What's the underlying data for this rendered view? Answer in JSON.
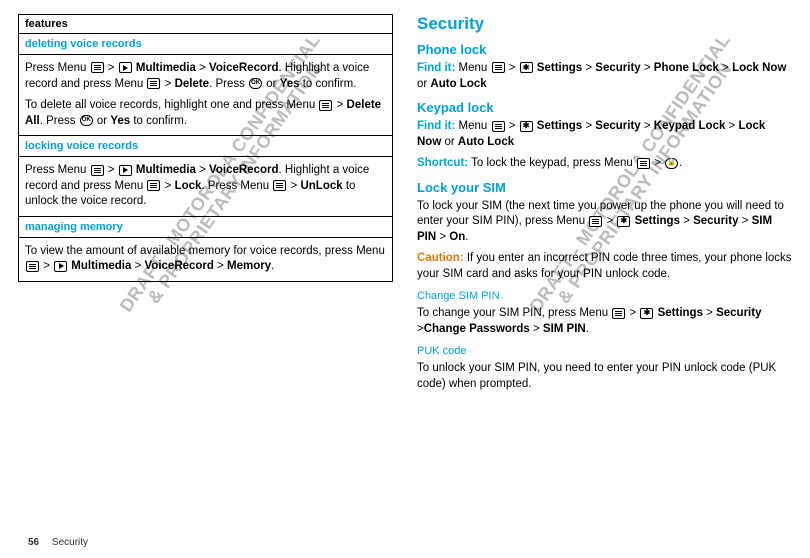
{
  "watermark": "DRAFT - MOTOROLA CONFIDENTIAL\n& PROPRIETARY INFORMATION",
  "left": {
    "features": "features",
    "s1_title": "deleting voice records",
    "s1_p1a": "Press Menu ",
    "s1_p1b": " > ",
    "s1_p1c": " Multimedia",
    "s1_p1d": " > ",
    "s1_p1e": "VoiceRecord",
    "s1_p1f": ". Highlight a voice record and press Menu ",
    "s1_p1g": " > ",
    "s1_p1h": "Delete",
    "s1_p1i": ". Press ",
    "s1_p1j": " or ",
    "s1_p1k": "Yes",
    "s1_p1l": " to confirm.",
    "s1_p2a": "To delete all voice records, highlight one and press Menu ",
    "s1_p2b": " > ",
    "s1_p2c": "Delete All",
    "s1_p2d": ". Press ",
    "s1_p2e": " or ",
    "s1_p2f": "Yes",
    "s1_p2g": " to confirm.",
    "s2_title": "locking voice records",
    "s2_p1a": "Press Menu ",
    "s2_p1b": " > ",
    "s2_p1c": " Multimedia",
    "s2_p1d": " > ",
    "s2_p1e": "VoiceRecord",
    "s2_p1f": ". Highlight a voice record and press Menu ",
    "s2_p1g": " > ",
    "s2_p1h": "Lock",
    "s2_p1i": ". Press Menu ",
    "s2_p1j": " > ",
    "s2_p1k": "UnLock",
    "s2_p1l": " to unlock the voice record.",
    "s3_title": "managing memory",
    "s3_p1a": "To view the amount of available memory for voice records, press Menu ",
    "s3_p1b": " > ",
    "s3_p1c": " Multimedia",
    "s3_p1d": " > ",
    "s3_p1e": "VoiceRecord",
    "s3_p1f": " > ",
    "s3_p1g": "Memory",
    "s3_p1h": "."
  },
  "right": {
    "h1": "Security",
    "phone_lock": "Phone lock",
    "find_it": "Find it:",
    "pl_a": " Menu ",
    "pl_b": " > ",
    "pl_c": " Settings",
    "pl_d": " > ",
    "pl_e": "Security",
    "pl_f": " > ",
    "pl_g": "Phone Lock",
    "pl_h": " > ",
    "pl_i": "Lock Now",
    "pl_j": " or ",
    "pl_k": "Auto Lock",
    "keypad_lock": "Keypad lock",
    "kl_a": " Menu ",
    "kl_b": " > ",
    "kl_c": " Settings",
    "kl_d": " > ",
    "kl_e": "Security",
    "kl_f": " > ",
    "kl_g": "Keypad Lock",
    "kl_h": " > ",
    "kl_i": "Lock Now",
    "kl_j": " or ",
    "kl_k": "Auto Lock",
    "shortcut": "Shortcut:",
    "sc_a": " To lock the keypad, press Menu ",
    "sc_b": " > ",
    "sc_c": ".",
    "lock_sim": "Lock your SIM",
    "ls_a": "To lock your SIM (the next time you power up the phone you will need to enter your SIM PIN), press Menu ",
    "ls_b": " > ",
    "ls_c": " Settings",
    "ls_d": " > ",
    "ls_e": "Security",
    "ls_f": " > ",
    "ls_g": "SIM PIN",
    "ls_h": " > ",
    "ls_i": "On",
    "ls_j": ".",
    "caution": "Caution:",
    "caution_text": " If you enter an incorrect PIN code three times, your phone locks your SIM card and asks for your PIN unlock code.",
    "change_pin": "Change SIM PIN",
    "cp_a": "To change your SIM PIN, press Menu ",
    "cp_b": " > ",
    "cp_c": " Settings",
    "cp_d": " > ",
    "cp_e": "Security",
    "cp_f": " >",
    "cp_g": "Change Passwords",
    "cp_h": " > ",
    "cp_i": "SIM PIN",
    "cp_j": ".",
    "puk": "PUK code",
    "puk_text": "To unlock your SIM PIN, you need to enter your PIN unlock code (PUK code) when prompted."
  },
  "footer": {
    "page": "56",
    "section": "Security"
  },
  "ok": "OK"
}
